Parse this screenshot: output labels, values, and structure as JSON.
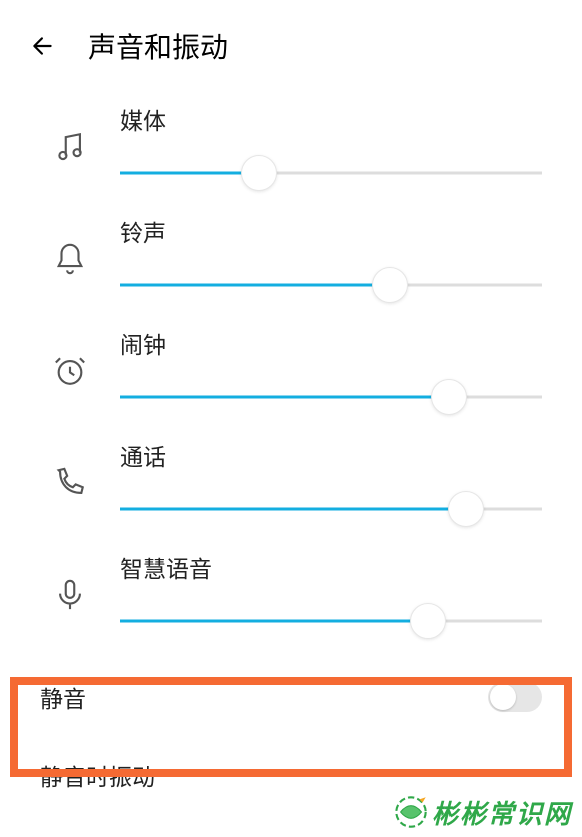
{
  "header": {
    "title": "声音和振动"
  },
  "sliders": [
    {
      "label": "媒体",
      "value": 33,
      "icon": "music"
    },
    {
      "label": "铃声",
      "value": 64,
      "icon": "bell"
    },
    {
      "label": "闹钟",
      "value": 78,
      "icon": "alarm"
    },
    {
      "label": "通话",
      "value": 82,
      "icon": "phone"
    },
    {
      "label": "智慧语音",
      "value": 73,
      "icon": "mic"
    }
  ],
  "settings": {
    "mute": {
      "label": "静音",
      "on": false
    },
    "vibrate_on_mute": {
      "label": "静音时振动"
    }
  },
  "watermark": "彬彬常识网"
}
